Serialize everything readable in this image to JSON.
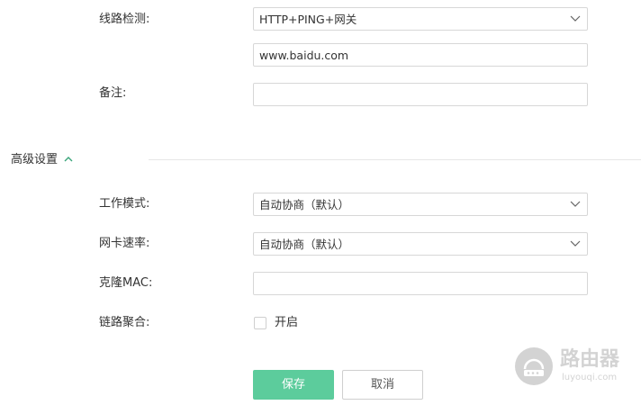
{
  "form": {
    "line_detect": {
      "label": "线路检测:",
      "value": "HTTP+PING+网关",
      "host_value": "www.baidu.com"
    },
    "remark": {
      "label": "备注:",
      "value": ""
    },
    "advanced": {
      "title": "高级设置",
      "work_mode": {
        "label": "工作模式:",
        "value": "自动协商（默认）"
      },
      "nic_speed": {
        "label": "网卡速率:",
        "value": "自动协商（默认）"
      },
      "clone_mac": {
        "label": "克隆MAC:",
        "value": ""
      },
      "link_aggregation": {
        "label": "链路聚合:",
        "checkbox_label": "开启",
        "checked": false
      }
    },
    "buttons": {
      "save": "保存",
      "cancel": "取消"
    }
  },
  "watermark": {
    "title": "路由器",
    "subtitle": "luyouqi.com"
  },
  "colors": {
    "primary": "#5ccc9c",
    "border": "#d7d7d7",
    "text": "#333333",
    "watermark": "#cccccc"
  }
}
